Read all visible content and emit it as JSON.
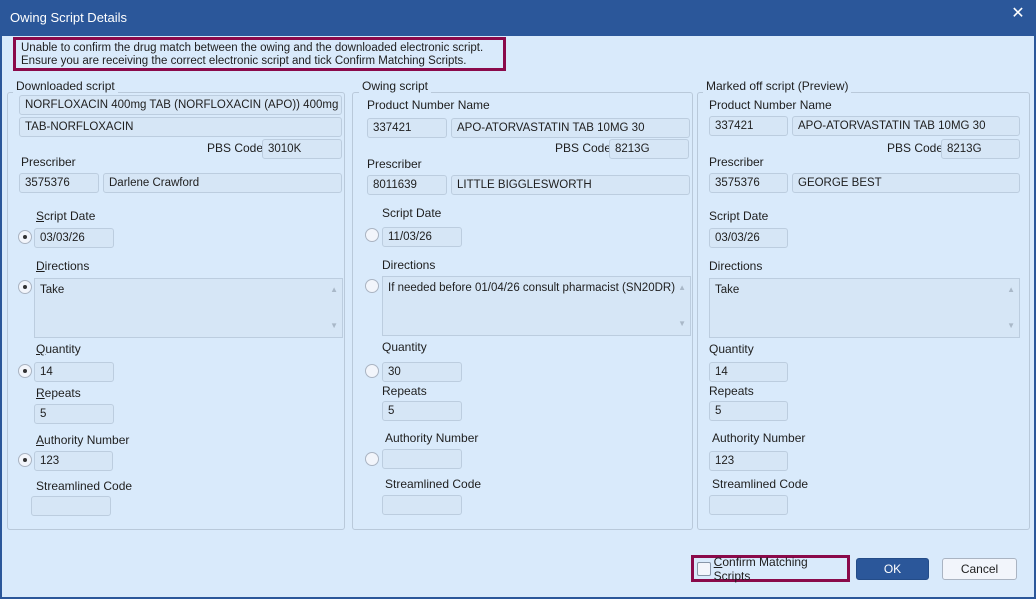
{
  "window": {
    "title": "Owing Script Details",
    "close_icon": "close-icon"
  },
  "warning": {
    "line1": "Unable to confirm the drug match between the owing and the downloaded electronic script.",
    "line2": "Ensure you are receiving the correct electronic script and tick Confirm Matching Scripts."
  },
  "labels": {
    "product_number_name": "Product Number Name",
    "pbs_code": "PBS Code",
    "prescriber": "Prescriber",
    "script_date": "Script Date",
    "directions": "Directions",
    "quantity": "Quantity",
    "repeats": "Repeats",
    "authority_number": "Authority Number",
    "streamlined_code": "Streamlined Code"
  },
  "downloaded": {
    "title": "Downloaded script",
    "drug_line1": "NORFLOXACIN 400mg TAB (NORFLOXACIN (APO)) 400mg",
    "drug_line2": "TAB-NORFLOXACIN",
    "pbs_code": "3010K",
    "prescriber_number": "3575376",
    "prescriber_name": "Darlene Crawford",
    "script_date": "03/03/26",
    "directions": "Take",
    "quantity": "14",
    "repeats": "5",
    "authority_number": "123",
    "streamlined_code": ""
  },
  "owing": {
    "title": "Owing script",
    "product_number": "337421",
    "product_name": "APO-ATORVASTATIN TAB 10MG 30",
    "pbs_code": "8213G",
    "prescriber_number": "8011639",
    "prescriber_name": "LITTLE BIGGLESWORTH",
    "script_date": "11/03/26",
    "directions": "If needed before 01/04/26 consult pharmacist (SN20DR)",
    "quantity": "30",
    "repeats": "5",
    "authority_number": "",
    "streamlined_code": ""
  },
  "marked": {
    "title": "Marked off script (Preview)",
    "product_number": "337421",
    "product_name": "APO-ATORVASTATIN TAB 10MG 30",
    "pbs_code": "8213G",
    "prescriber_number": "3575376",
    "prescriber_name": "GEORGE BEST",
    "script_date": "03/03/26",
    "directions": "Take",
    "quantity": "14",
    "repeats": "5",
    "authority_number": "123",
    "streamlined_code": ""
  },
  "footer": {
    "confirm_label": "Confirm Matching Scripts",
    "confirm_checked": false,
    "ok_label": "OK",
    "cancel_label": "Cancel"
  }
}
